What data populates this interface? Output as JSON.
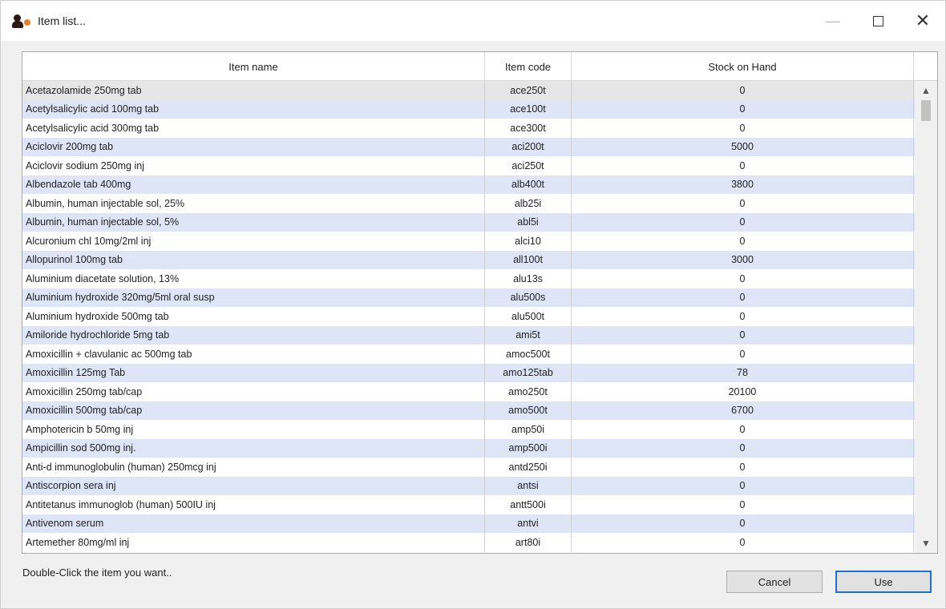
{
  "window": {
    "title": "Item list..."
  },
  "table": {
    "columns": [
      "Item name",
      "Item code",
      "Stock on Hand"
    ],
    "rows": [
      [
        "Acetazolamide 250mg tab",
        "ace250t",
        "0"
      ],
      [
        "Acetylsalicylic acid 100mg  tab",
        "ace100t",
        "0"
      ],
      [
        "Acetylsalicylic acid 300mg tab",
        "ace300t",
        "0"
      ],
      [
        "Aciclovir 200mg tab",
        "aci200t",
        "5000"
      ],
      [
        "Aciclovir sodium 250mg inj",
        "aci250t",
        "0"
      ],
      [
        "Albendazole tab 400mg",
        "alb400t",
        "3800"
      ],
      [
        "Albumin, human injectable sol, 25%",
        "alb25i",
        "0"
      ],
      [
        "Albumin, human injectable sol, 5%",
        "abl5i",
        "0"
      ],
      [
        "Alcuronium chl 10mg/2ml inj",
        "alci10",
        "0"
      ],
      [
        "Allopurinol 100mg tab",
        "all100t",
        "3000"
      ],
      [
        "Aluminium diacetate solution, 13%",
        "alu13s",
        "0"
      ],
      [
        "Aluminium hydroxide 320mg/5ml oral susp",
        "alu500s",
        "0"
      ],
      [
        "Aluminium hydroxide 500mg tab",
        "alu500t",
        "0"
      ],
      [
        "Amiloride hydrochloride 5mg tab",
        "ami5t",
        "0"
      ],
      [
        "Amoxicillin + clavulanic ac 500mg tab",
        "amoc500t",
        "0"
      ],
      [
        "Amoxicillin 125mg Tab",
        "amo125tab",
        "78"
      ],
      [
        "Amoxicillin 250mg tab/cap",
        "amo250t",
        "20100"
      ],
      [
        "Amoxicillin 500mg tab/cap",
        "amo500t",
        "6700"
      ],
      [
        "Amphotericin b 50mg inj",
        "amp50i",
        "0"
      ],
      [
        "Ampicillin sod 500mg inj.",
        "amp500i",
        "0"
      ],
      [
        "Anti-d immunoglobulin (human) 250mcg inj",
        "antd250i",
        "0"
      ],
      [
        "Antiscorpion sera inj",
        "antsi",
        "0"
      ],
      [
        "Antitetanus immunoglob (human) 500IU inj",
        "antt500i",
        "0"
      ],
      [
        "Antivenom serum",
        "antvi",
        "0"
      ],
      [
        "Artemether 80mg/ml inj",
        "art80i",
        "0"
      ]
    ]
  },
  "footer": {
    "hint": "Double-Click the item you want..",
    "cancel_label": "Cancel",
    "use_label": "Use"
  },
  "colors": {
    "row_alt": "#dde5f6",
    "focus_border": "#1d6fd0"
  },
  "icons": [
    "app-logo-icon",
    "minimize-icon",
    "maximize-icon",
    "close-icon",
    "scroll-up-icon",
    "scroll-down-icon"
  ]
}
